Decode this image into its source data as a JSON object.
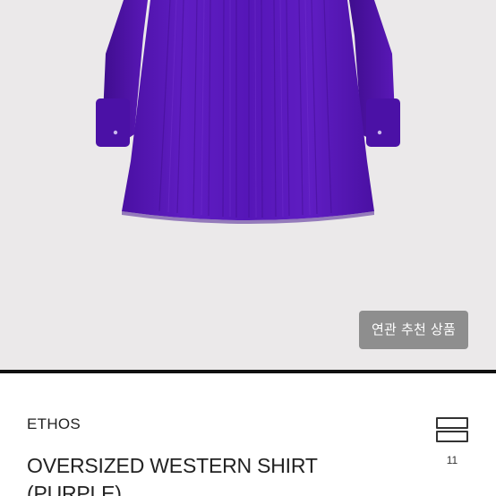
{
  "product_image": {
    "alt": "purple shirt",
    "garment_color": "#5a17b8",
    "background_color": "#ebe9ea"
  },
  "related_button": {
    "label": "연관 추천 상품"
  },
  "product": {
    "brand": "ETHOS",
    "title": "OVERSIZED WESTERN SHIRT (PURPLE)"
  },
  "menu": {
    "icon": "list-view-icon",
    "count": "11"
  }
}
